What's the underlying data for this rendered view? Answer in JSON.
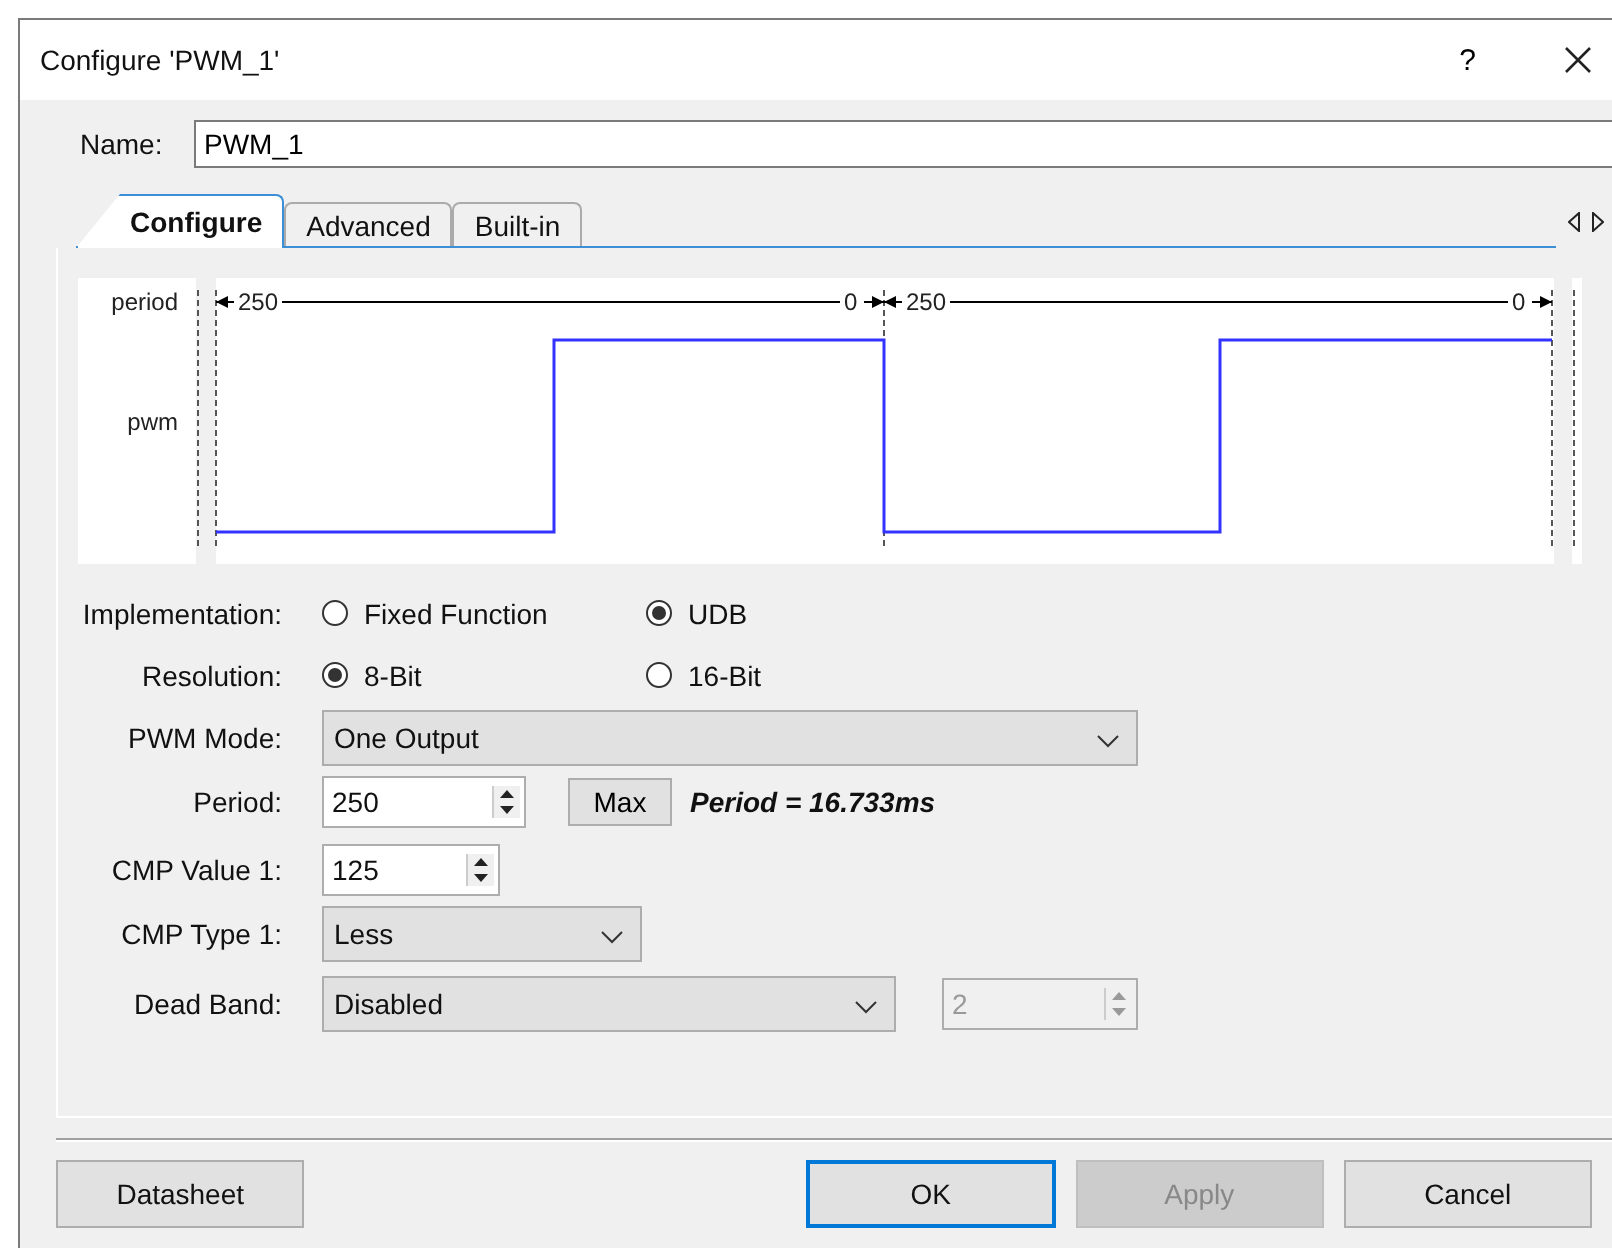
{
  "window": {
    "title": "Configure 'PWM_1'",
    "help": "?"
  },
  "name_field": {
    "label": "Name:",
    "value": "PWM_1"
  },
  "tabs": [
    {
      "label": "Configure",
      "selected": true
    },
    {
      "label": "Advanced",
      "selected": false
    },
    {
      "label": "Built-in",
      "selected": false
    }
  ],
  "diagram": {
    "row_labels": [
      "period",
      "pwm"
    ],
    "periods": [
      {
        "start": "250",
        "end": "0"
      },
      {
        "start": "250",
        "end": "0"
      }
    ]
  },
  "form": [
    {
      "kind": "radio",
      "label": "Implementation:",
      "options": [
        {
          "label": "Fixed Function",
          "selected": false
        },
        {
          "label": "UDB",
          "selected": true
        }
      ]
    },
    {
      "kind": "radio",
      "label": "Resolution:",
      "options": [
        {
          "label": "8-Bit",
          "selected": true
        },
        {
          "label": "16-Bit",
          "selected": false
        }
      ]
    },
    {
      "kind": "dropdown",
      "label": "PWM Mode:",
      "value": "One Output"
    },
    {
      "kind": "spinner",
      "label": "Period:",
      "value": "250",
      "button": "Max",
      "note": "Period = 16.733ms"
    },
    {
      "kind": "spinner",
      "label": "CMP Value 1:",
      "value": "125"
    },
    {
      "kind": "dropdown",
      "label": "CMP Type 1:",
      "value": "Less"
    },
    {
      "kind": "dropdown",
      "label": "Dead Band:",
      "value": "Disabled",
      "extra": {
        "value": "2",
        "disabled": true
      }
    }
  ],
  "buttons": [
    {
      "label": "Datasheet",
      "default": false,
      "disabled": false
    },
    {
      "label": "OK",
      "default": true,
      "disabled": false
    },
    {
      "label": "Apply",
      "default": false,
      "disabled": true
    },
    {
      "label": "Cancel",
      "default": false,
      "disabled": false
    }
  ]
}
